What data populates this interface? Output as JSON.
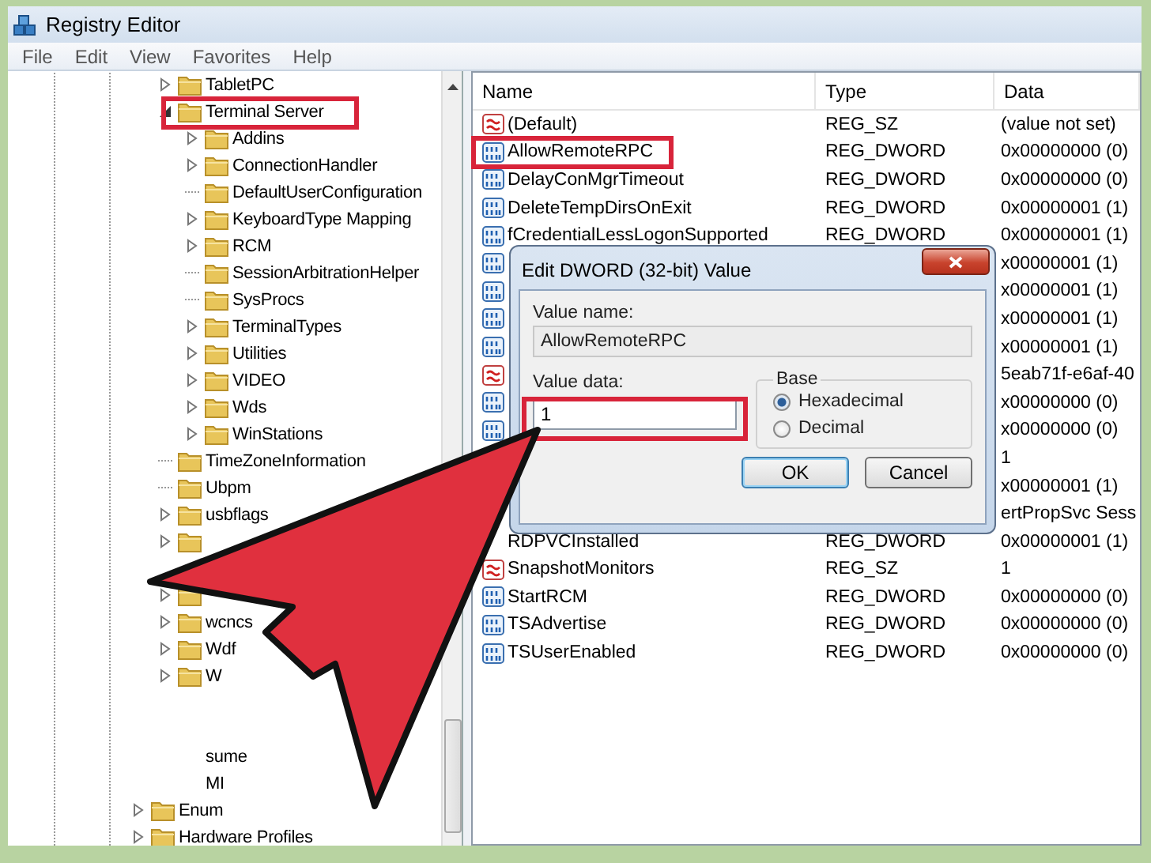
{
  "window": {
    "title": "Registry Editor"
  },
  "menu": [
    "File",
    "Edit",
    "View",
    "Favorites",
    "Help"
  ],
  "tree": [
    {
      "kind": "group",
      "children": [
        {
          "kind": "folder",
          "label": "TabletPC",
          "expandable": true,
          "expanded": false
        },
        {
          "kind": "folder",
          "label": "Terminal Server",
          "expandable": true,
          "expanded": true,
          "children": [
            {
              "kind": "folder",
              "label": "Addins",
              "expandable": true,
              "expanded": false
            },
            {
              "kind": "folder",
              "label": "ConnectionHandler",
              "expandable": true,
              "expanded": false
            },
            {
              "kind": "folder",
              "label": "DefaultUserConfiguration",
              "expandable": false
            },
            {
              "kind": "folder",
              "label": "KeyboardType Mapping",
              "expandable": true,
              "expanded": false
            },
            {
              "kind": "folder",
              "label": "RCM",
              "expandable": true,
              "expanded": false
            },
            {
              "kind": "folder",
              "label": "SessionArbitrationHelper",
              "expandable": false
            },
            {
              "kind": "folder",
              "label": "SysProcs",
              "expandable": false
            },
            {
              "kind": "folder",
              "label": "TerminalTypes",
              "expandable": true,
              "expanded": false
            },
            {
              "kind": "folder",
              "label": "Utilities",
              "expandable": true,
              "expanded": false
            },
            {
              "kind": "folder",
              "label": "VIDEO",
              "expandable": true,
              "expanded": false
            },
            {
              "kind": "folder",
              "label": "Wds",
              "expandable": true,
              "expanded": false
            },
            {
              "kind": "folder",
              "label": "WinStations",
              "expandable": true,
              "expanded": false
            }
          ]
        },
        {
          "kind": "folder",
          "label": "TimeZoneInformation",
          "expandable": false
        },
        {
          "kind": "folder",
          "label": "Ubpm",
          "expandable": false
        },
        {
          "kind": "folder",
          "label": "usbflags",
          "expandable": true,
          "expanded": false
        },
        {
          "kind": "folder",
          "expandable": true,
          "expanded": false
        },
        {
          "kind": "blank"
        },
        {
          "kind": "folder",
          "expandable": true,
          "expanded": false
        },
        {
          "kind": "folder",
          "label": "wcncs",
          "expandable": true,
          "expanded": false
        },
        {
          "kind": "folder",
          "label": "Wdf",
          "expandable": true,
          "expanded": false
        },
        {
          "kind": "folder",
          "label": "W",
          "expandable": true,
          "expanded": false
        },
        {
          "kind": "blank"
        },
        {
          "kind": "blank"
        },
        {
          "kind": "text",
          "label": "sume"
        },
        {
          "kind": "text",
          "label": "MI"
        }
      ]
    },
    {
      "kind": "folder",
      "label": "Enum",
      "expandable": true,
      "expanded": false
    },
    {
      "kind": "folder",
      "label": "Hardware Profiles",
      "expandable": true,
      "expanded": false
    }
  ],
  "list": {
    "columns": [
      "Name",
      "Type",
      "Data"
    ],
    "rows": [
      {
        "kind": "string",
        "name": "(Default)",
        "type": "REG_SZ",
        "data": "(value not set)"
      },
      {
        "kind": "dword",
        "name": "AllowRemoteRPC",
        "type": "REG_DWORD",
        "data": "0x00000000 (0)"
      },
      {
        "kind": "dword",
        "name": "DelayConMgrTimeout",
        "type": "REG_DWORD",
        "data": "0x00000000 (0)"
      },
      {
        "kind": "dword",
        "name": "DeleteTempDirsOnExit",
        "type": "REG_DWORD",
        "data": "0x00000001 (1)"
      },
      {
        "kind": "dword",
        "name": "fCredentialLessLogonSupported",
        "type": "REG_DWORD",
        "data": "0x00000001 (1)"
      },
      {
        "kind": "dword",
        "data": "x00000001 (1)"
      },
      {
        "kind": "dword",
        "data": "x00000001 (1)"
      },
      {
        "kind": "dword",
        "data": "x00000001 (1)"
      },
      {
        "kind": "dword",
        "data": "x00000001 (1)"
      },
      {
        "kind": "string",
        "data": "5eab71f-e6af-40"
      },
      {
        "kind": "dword",
        "data": "x00000000 (0)"
      },
      {
        "kind": "dword",
        "data": "x00000000 (0)"
      },
      {
        "data": "1"
      },
      {
        "data": "x00000001 (1)"
      },
      {
        "data": "ertPropSvc Sess"
      },
      {
        "name": "RDPVCInstalled",
        "type": "REG_DWORD",
        "data": "0x00000001 (1)"
      },
      {
        "kind": "string",
        "name": "SnapshotMonitors",
        "type": "REG_SZ",
        "data": "1"
      },
      {
        "kind": "dword",
        "name": "StartRCM",
        "type": "REG_DWORD",
        "data": "0x00000000 (0)"
      },
      {
        "kind": "dword",
        "name": "TSAdvertise",
        "type": "REG_DWORD",
        "data": "0x00000000 (0)"
      },
      {
        "kind": "dword",
        "name": "TSUserEnabled",
        "type": "REG_DWORD",
        "data": "0x00000000 (0)"
      }
    ]
  },
  "dialog": {
    "title": "Edit DWORD (32-bit) Value",
    "value_name_label": "Value name:",
    "value_name": "AllowRemoteRPC",
    "value_data_label": "Value data:",
    "value_data": "1",
    "base_label": "Base",
    "bases": [
      {
        "label": "Hexadecimal",
        "selected": true
      },
      {
        "label": "Decimal",
        "selected": false
      }
    ],
    "buttons": [
      {
        "label": "OK",
        "default": true
      },
      {
        "label": "Cancel",
        "default": false
      }
    ]
  }
}
